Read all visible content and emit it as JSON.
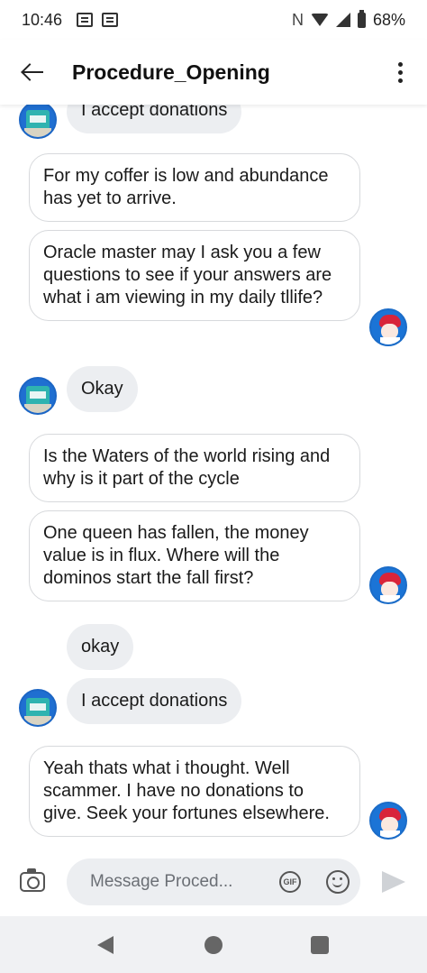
{
  "status_bar": {
    "time": "10:46",
    "battery": "68%",
    "nfc": "N"
  },
  "header": {
    "title": "Procedure_Opening"
  },
  "messages": [
    {
      "sender": "other",
      "text": "I accept donations"
    },
    {
      "sender": "me",
      "text": "For my coffer is low and abundance has yet to arrive."
    },
    {
      "sender": "me",
      "text": "Oracle master may I ask you a few questions to see if your answers are what i am viewing in my daily tllife?"
    },
    {
      "sender": "other",
      "text": "Okay"
    },
    {
      "sender": "me",
      "text": "Is the Waters of the world rising and why is it part of the cycle"
    },
    {
      "sender": "me",
      "text": "One queen has fallen, the money value is in flux. Where will the dominos start the fall first?"
    },
    {
      "sender": "other",
      "text": "okay"
    },
    {
      "sender": "other",
      "text": "I accept donations"
    },
    {
      "sender": "me",
      "text": "Yeah thats what i thought. Well scammer. I have no donations to give. Seek your fortunes elsewhere."
    }
  ],
  "composer": {
    "placeholder": "Message Proced...",
    "gif_label": "GIF"
  },
  "icons": {
    "back": "back-arrow-icon",
    "menu": "more-vert-icon",
    "camera": "camera-icon",
    "gif": "gif-icon",
    "emoji": "emoji-icon",
    "send": "send-icon"
  },
  "colors": {
    "incoming_bubble": "#eceef1",
    "outgoing_border": "#d7d9dc",
    "avatar_blue": "#1b74d6"
  }
}
